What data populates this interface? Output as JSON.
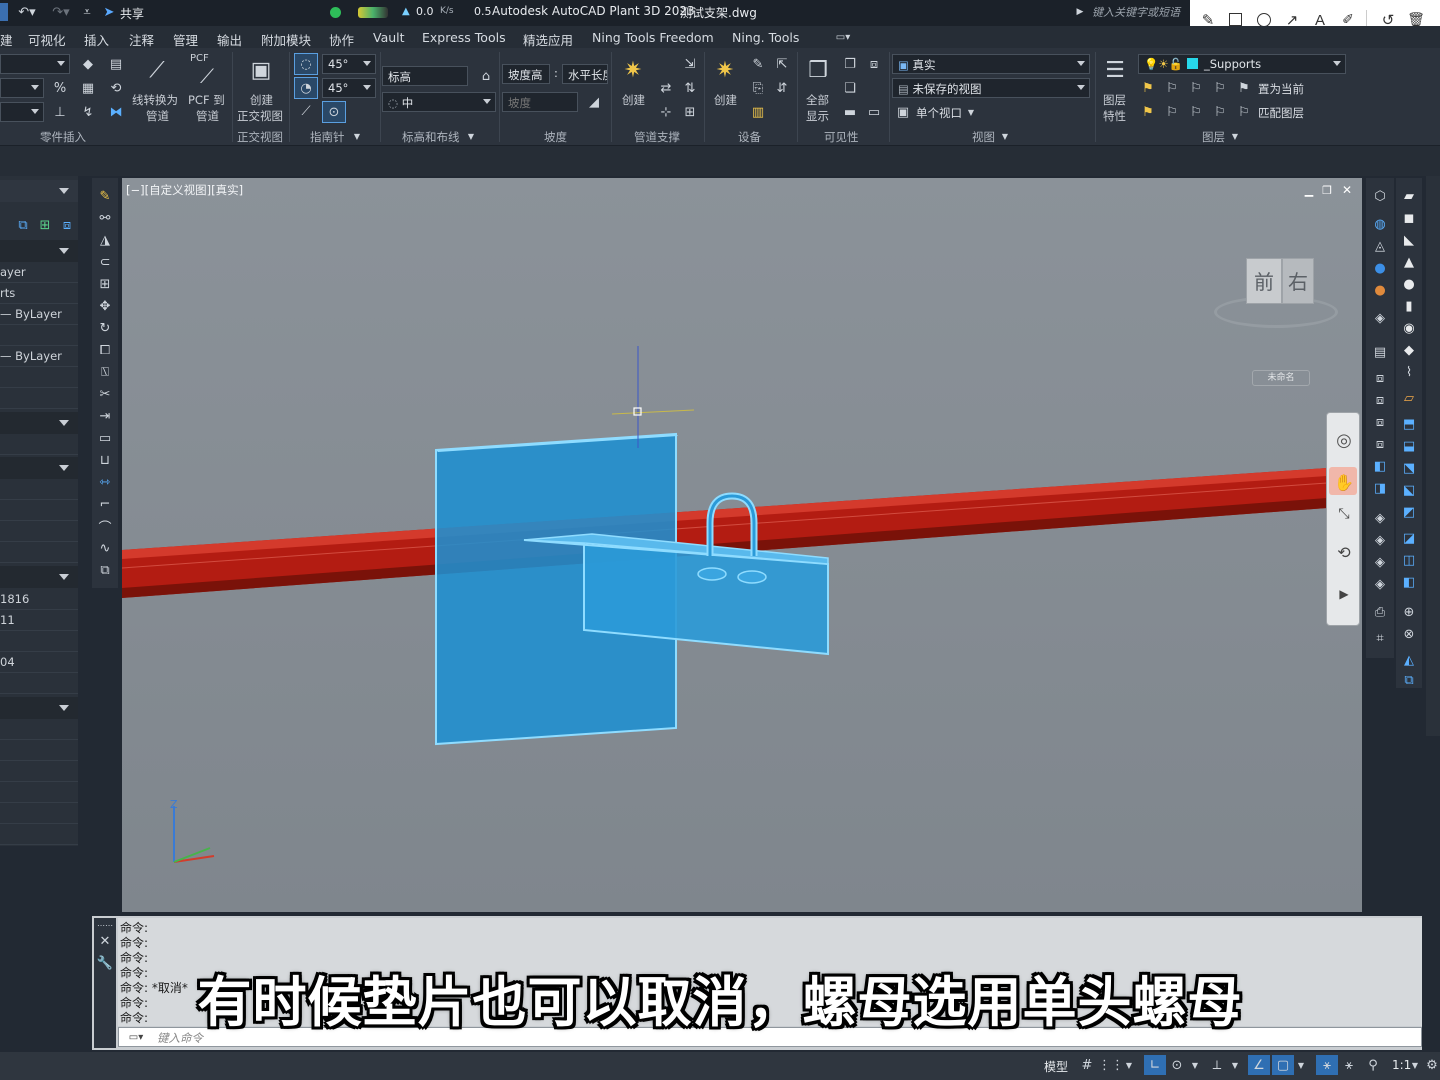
{
  "titlebar": {
    "share": "共享",
    "speed_value": "0.0",
    "speed_unit": "K/s",
    "speed_value2": "0.5",
    "app_title": "Autodesk AutoCAD Plant 3D 2023",
    "file_name": "测试支架.dwg",
    "search_placeholder": "键入关键字或短语"
  },
  "menubar": {
    "items": [
      "建",
      "可视化",
      "插入",
      "注释",
      "管理",
      "输出",
      "附加模块",
      "协作",
      "Vault",
      "Express Tools",
      "精选应用",
      "Ning Tools Freedom",
      "Ning. Tools"
    ]
  },
  "ribbon": {
    "panel_part_insert": "零件插入",
    "line_to_pipe": "线转换为",
    "line_to_pipe2": "管道",
    "pcf_label": "PCF",
    "pcf_to_pipe": "PCF 到",
    "pcf_to_pipe2": "管道",
    "create_ortho": "创建",
    "create_ortho2": "正交视图",
    "panel_ortho": "正交视图",
    "angle1": "45°",
    "angle2": "45°",
    "panel_compass": "指南针",
    "elevation": "标高",
    "elevation_mid": "中",
    "panel_elev_routing": "标高和布线",
    "slope_height": "坡度高",
    "horizontal_length": "水平长度",
    "slope": "坡度",
    "panel_slope": "坡度",
    "create_support": "创建",
    "panel_pipe_support": "管道支撑",
    "create_equipment": "创建",
    "panel_equipment": "设备",
    "show_all": "全部",
    "show_all2": "显示",
    "panel_visibility": "可见性",
    "visual_style": "真实",
    "saved_view": "未保存的视图",
    "single_viewport": "单个视口",
    "panel_view": "视图",
    "layer_props": "图层",
    "layer_props2": "特性",
    "layer_name": "_Supports",
    "set_current": "置为当前",
    "match_layer": "匹配图层",
    "panel_layers": "图层"
  },
  "leftpanel": {
    "rows": [
      "ayer",
      "rts",
      "— ByLayer",
      "— ByLayer",
      "",
      "1816",
      "11",
      "",
      "04"
    ]
  },
  "viewport": {
    "label": "[−][自定义视图][真实]",
    "viewcube_front": "前",
    "viewcube_right": "右",
    "unnamed": "未命名",
    "ucs_z": "Z"
  },
  "colors": {
    "pipe": "#b01f14",
    "support": "#1e8fd0",
    "support_edge": "#7fd4ff",
    "viewport_bg": "#858c93"
  },
  "command": {
    "history": [
      "命令:",
      "命令:",
      "命令:",
      "命令:",
      "命令: *取消*",
      "命令:",
      "命令:"
    ],
    "input_placeholder": "键入命令"
  },
  "statusbar": {
    "model": "模型",
    "scale": "1:1"
  },
  "subtitle": "有时候垫片也可以取消，螺母选用单头螺母"
}
